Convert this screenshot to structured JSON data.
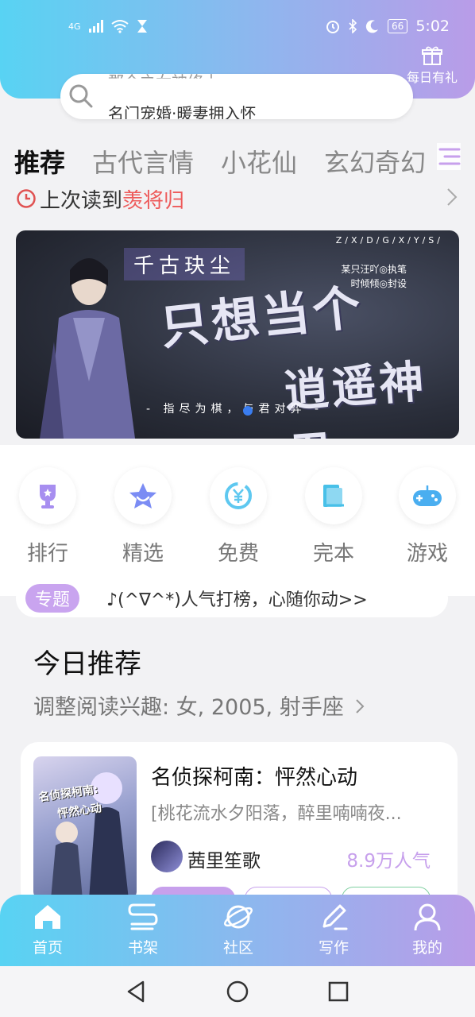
{
  "status_bar": {
    "network": "4G",
    "time": "5:02",
    "battery": "66"
  },
  "header": {
    "gift_label": "每日有礼"
  },
  "search": {
    "ghost_text": "郡众之女神修士",
    "hint": "名门宠婚·暖妻拥入怀"
  },
  "tabs": [
    "推荐",
    "古代言情",
    "小花仙",
    "玄幻奇幻"
  ],
  "last_read": {
    "prefix": "上次读到",
    "title": "羡将归"
  },
  "banner": {
    "top_title": "千古玦尘",
    "code": "Z/X/D/G/X/Y/S/",
    "credit_line1": "某只汪吖◎执笔",
    "credit_line2": "时倾倾◎封设",
    "main_line1": "只想当个",
    "main_line2": "逍遥神君",
    "subtitle": "- 指尽为棋，与君对弈 -"
  },
  "quick_links": [
    {
      "label": "排行",
      "icon": "trophy-icon",
      "color": "#a78ef0"
    },
    {
      "label": "精选",
      "icon": "star-icon",
      "color": "#7b8cf4"
    },
    {
      "label": "免费",
      "icon": "yuan-icon",
      "color": "#5ec8f0"
    },
    {
      "label": "完本",
      "icon": "book-icon",
      "color": "#48c0e8"
    },
    {
      "label": "游戏",
      "icon": "gamepad-icon",
      "color": "#4aaef0"
    }
  ],
  "topic": {
    "badge": "专题",
    "text": "♪(^∇^*)人气打榜，心随你动>>"
  },
  "recommend": {
    "title": "今日推荐",
    "subtitle": "调整阅读兴趣: 女, 2005, 射手座"
  },
  "book": {
    "title": "名侦探柯南：怦然心动",
    "description": "[桃花流水夕阳落，醉里喃喃夜...",
    "author": "茜里笙歌",
    "popularity": "8.9万人气",
    "cover_text1": "名侦探柯南:",
    "cover_text2": "怦然心动"
  },
  "bottom_nav": [
    {
      "label": "首页",
      "icon": "home-icon"
    },
    {
      "label": "书架",
      "icon": "bookshelf-icon"
    },
    {
      "label": "社区",
      "icon": "planet-icon"
    },
    {
      "label": "写作",
      "icon": "pen-icon"
    },
    {
      "label": "我的",
      "icon": "user-icon"
    }
  ],
  "colors": {
    "gradient_start": "#58d3f3",
    "gradient_end": "#b99ce8",
    "accent": "#c7a0ec",
    "highlight": "#ee5a5a"
  }
}
